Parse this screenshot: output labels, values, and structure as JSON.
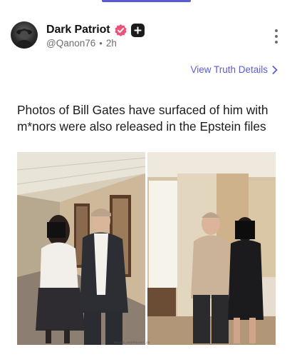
{
  "post": {
    "author": {
      "display_name": "Dark Patriot",
      "handle": "@Qanon76",
      "time_ago": "2h",
      "separator": "•"
    },
    "view_details_label": "View Truth Details",
    "text": "Photos of Bill Gates have surfaced of him with m*nors were also released in the Epstein files",
    "media": {
      "watermark": "HOUSE_OVERSIGHT_00"
    }
  },
  "colors": {
    "accent": "#5b5bd6",
    "verified_badge": "#e8547a",
    "text_primary": "#1c1c1e",
    "text_secondary": "#6e6e73"
  },
  "icons": {
    "verified": "verified-badge-icon",
    "plus": "plus-icon",
    "more": "more-vertical-icon",
    "chevron": "chevron-right-icon"
  }
}
